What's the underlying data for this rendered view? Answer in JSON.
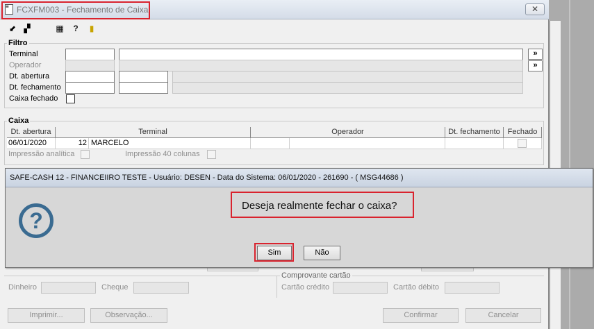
{
  "window": {
    "title": "FCXFM003 - Fechamento de Caixa",
    "close_symbol": "✕"
  },
  "toolbar": {
    "icons": [
      "arrow-icon",
      "copy-icon",
      "calendar-icon",
      "help-icon",
      "exit-icon"
    ]
  },
  "filtro": {
    "label": "Filtro",
    "terminal_label": "Terminal",
    "operador_label": "Operador",
    "dt_abertura_label": "Dt. abertura",
    "dt_fechamento_label": "Dt. fechamento",
    "caixa_fechado_label": "Caixa fechado",
    "lookup_symbol": "»"
  },
  "caixa": {
    "label": "Caixa",
    "columns": [
      "Dt. abertura",
      "Terminal",
      "Operador",
      "Dt. fechamento",
      "Fechado"
    ],
    "rows": [
      {
        "dt_abertura": "06/01/2020",
        "terminal_num": "12",
        "terminal_name": "MARCELO",
        "operador": "",
        "dt_fechamento": "",
        "fechado": false
      }
    ],
    "impressao_analitica_label": "Impressão analítica",
    "impressao_40_label": "Impressão 40 colunas"
  },
  "comprovante": {
    "label": "Comprovante cartão",
    "dinheiro_label": "Dinheiro",
    "cheque_label": "Cheque",
    "cartao_credito_label": "Cartão crédito",
    "cartao_debito_label": "Cartão débito"
  },
  "footer": {
    "imprimir_label": "Imprimir...",
    "observacao_label": "Observação...",
    "confirmar_label": "Confirmar",
    "cancelar_label": "Cancelar"
  },
  "dialog": {
    "title": "SAFE-CASH 12 - FINANCEIIRO TESTE - Usuário: DESEN - Data do Sistema: 06/01/2020 - 261690 - ( MSG44686 )",
    "message": "Deseja realmente fechar o caixa?",
    "question_glyph": "?",
    "yes_label": "Sim",
    "no_label": "Não"
  },
  "colors": {
    "highlight": "#d9232e",
    "question_icon": "#3a6b91"
  }
}
